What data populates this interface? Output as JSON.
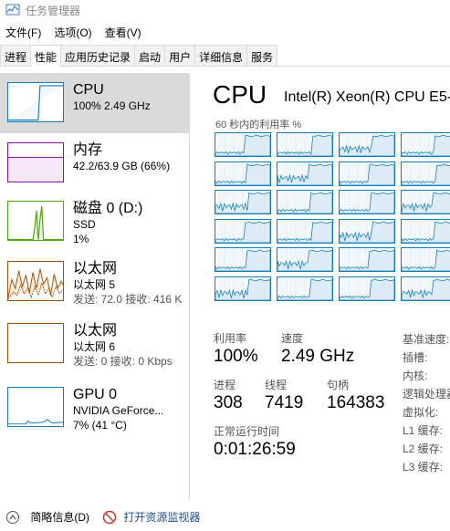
{
  "window": {
    "title": "任务管理器"
  },
  "menu": {
    "items": [
      "文件(F)",
      "选项(O)",
      "查看(V)"
    ]
  },
  "tabs": [
    "进程",
    "性能",
    "应用历史记录",
    "启动",
    "用户",
    "详细信息",
    "服务"
  ],
  "sidebar": {
    "items": [
      {
        "name": "CPU",
        "line1": "100% 2.49 GHz",
        "line2": ""
      },
      {
        "name": "内存",
        "line1": "42.2/63.9 GB (66%)",
        "line2": ""
      },
      {
        "name": "磁盘 0 (D:)",
        "line1": "SSD",
        "line2": "1%"
      },
      {
        "name": "以太网",
        "line1": "以太网 5",
        "line2": "发送: 72.0  接收: 416 K"
      },
      {
        "name": "以太网",
        "line1": "以太网 6",
        "line2": "发送: 0  接收: 0 Kbps"
      },
      {
        "name": "GPU 0",
        "line1": "NVIDIA GeForce...",
        "line2": "7% (41 °C)"
      }
    ]
  },
  "main": {
    "title": "CPU",
    "model": "Intel(R) Xeon(R) CPU E5-",
    "graph_label": "60 秒内的利用率 %",
    "stats": {
      "utilization_label": "利用率",
      "utilization": "100%",
      "speed_label": "速度",
      "speed": "2.49 GHz",
      "processes_label": "进程",
      "processes": "308",
      "threads_label": "线程",
      "threads": "7419",
      "handles_label": "句柄",
      "handles": "164383",
      "uptime_label": "正常运行时间",
      "uptime": "0:01:26:59"
    },
    "props": [
      "基准速度:",
      "插槽:",
      "内核:",
      "逻辑处理器:",
      "虚拟化:",
      "L1 缓存:",
      "L2 缓存:",
      "L3 缓存:"
    ]
  },
  "footer": {
    "fewer_details": "简略信息(D)",
    "resource_monitor": "打开资源监视器"
  },
  "colors": {
    "cpu": "#117dbb",
    "memory": "#8b12ae",
    "disk": "#4da60c",
    "ethernet": "#a74f01"
  }
}
